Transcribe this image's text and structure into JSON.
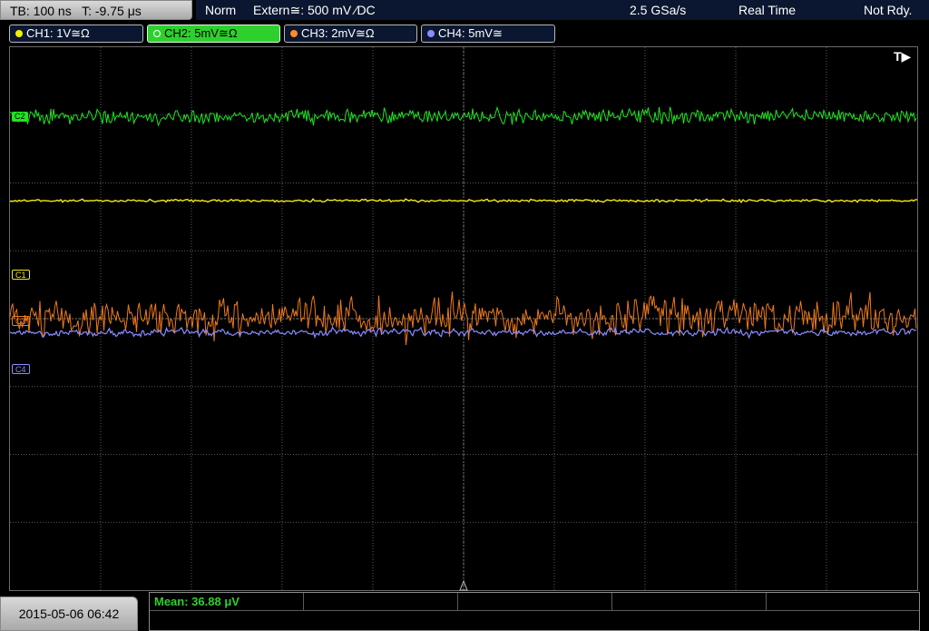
{
  "header": {
    "timebase": "TB: 100 ns   T: -9.75 μs",
    "mode": "Norm",
    "trigger": "Extern≅: 500 mV ⁄DC",
    "sample_rate": "2.5 GSa/s",
    "acq_mode": "Real Time",
    "state": "Not Rdy."
  },
  "channels": [
    {
      "label": "CH1: 1V≅Ω",
      "color": "#f5f000",
      "active": false
    },
    {
      "label": "CH2: 5mV≅Ω",
      "color": "#30e030",
      "active": true
    },
    {
      "label": "CH3: 2mV≅Ω",
      "color": "#ff8a2a",
      "active": false
    },
    {
      "label": "CH4: 5mV≅",
      "color": "#8a8cff",
      "active": false
    }
  ],
  "markers": {
    "c1": "C1",
    "c2": "C2",
    "c3": "C3",
    "c4": "C4",
    "trigger": "T▶"
  },
  "footer": {
    "datetime": "2015-05-06 06:42",
    "measurement": "Mean: 36.88 μV"
  },
  "colors": {
    "ch1": "#f0ea1a",
    "ch2": "#1ee61e",
    "ch3": "#ee7a1a",
    "ch4": "#8a8cff",
    "grid": "#5a5a5a"
  }
}
